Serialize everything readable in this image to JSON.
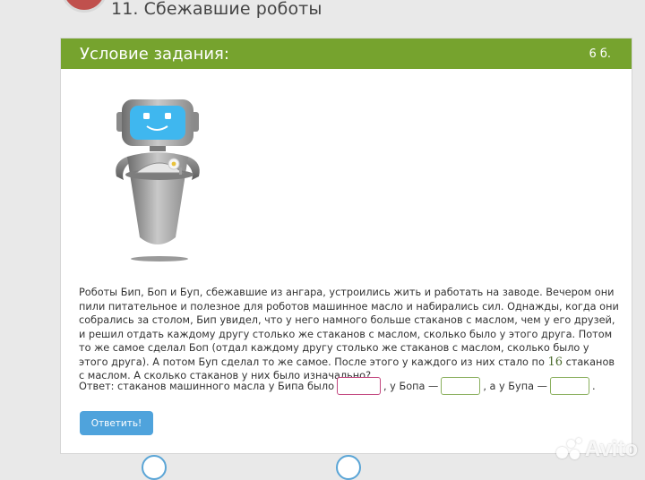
{
  "header": {
    "title": "11. Сбежавшие роботы"
  },
  "panel": {
    "title": "Условие задания:",
    "points": "6 б."
  },
  "task": {
    "text_before_number": "Роботы Бип, Боп и Буп, сбежавшие из ангара, устроились жить и работать на заводе. Вечером они пили питательное и полезное для роботов машинное масло и набирались сил. Однажды, когда они собрались за столом, Бип увидел, что у него намного больше стаканов с маслом, чем у его друзей, и решил отдать каждому другу столько же стаканов с маслом, сколько было у этого друга. Потом то же самое сделал Боп (отдал каждому другу столько же стаканов с маслом, сколько было у этого друга). А потом Буп сделал то же самое. После этого у каждого из них стало по",
    "number": "16",
    "text_after_number": "стаканов с маслом. А сколько стаканов у них было изначально?"
  },
  "answer": {
    "prefix": "Ответ: стаканов машинного масла у Бипа было",
    "bop_label": ", у Бопа —",
    "bup_label": ", а у Бупа —",
    "end": ".",
    "bip_value": "",
    "bop_value": "",
    "bup_value": ""
  },
  "submit_label": "Ответить!",
  "watermark": "Avito",
  "colors": {
    "header_green": "#76a32e",
    "button_blue": "#4fa3dc",
    "input_pink_border": "#c2477f",
    "input_green_border": "#8bb05f",
    "logo_red": "#c0504d"
  }
}
